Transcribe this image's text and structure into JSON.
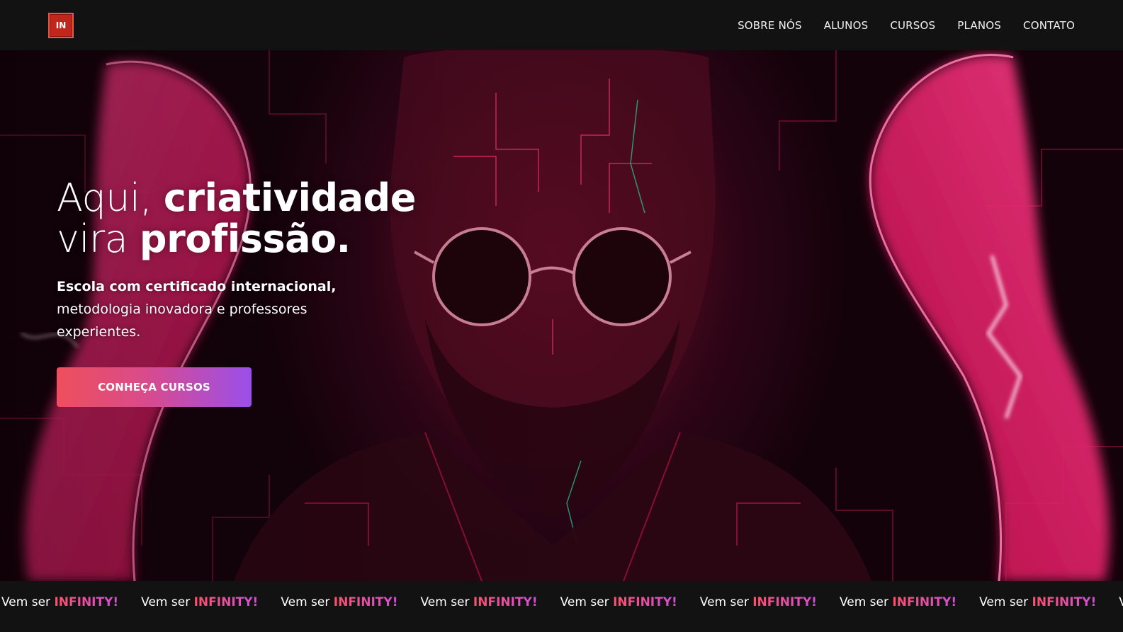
{
  "header": {
    "logo_text": "IN",
    "nav": [
      {
        "label": "SOBRE NÓS"
      },
      {
        "label": "ALUNOS"
      },
      {
        "label": "CURSOS"
      },
      {
        "label": "PLANOS"
      },
      {
        "label": "CONTATO"
      }
    ]
  },
  "hero": {
    "headline_line1_light": "Aqui, ",
    "headline_line1_bold": "criatividade",
    "headline_line2_light": "vira ",
    "headline_line2_bold": "profissão.",
    "subtext_bold": "Escola com certificado internacional,",
    "subtext_rest": " metodologia inovadora e professores experientes.",
    "cta_label": "CONHEÇA CURSOS",
    "image_description_icon": "bearded-man-sunglasses-neon-circuit-image"
  },
  "marquee": {
    "prefix": "Vem ser ",
    "brand": "INFINITY!",
    "repeat_count": 9
  },
  "colors": {
    "accent_red": "#c0261b",
    "cta_gradient_start": "#ef4e5c",
    "cta_gradient_end": "#9b4fea",
    "neon_pink": "#ff1f6e",
    "header_bg": "#121212"
  }
}
